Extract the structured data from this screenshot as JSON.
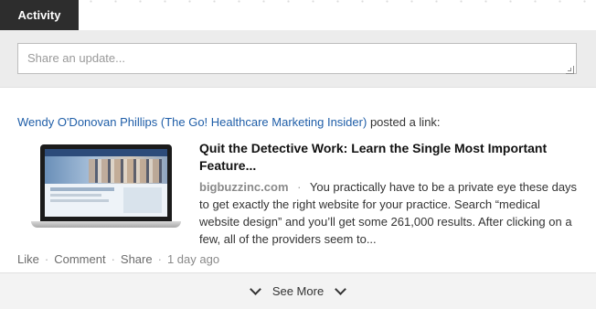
{
  "tabs": {
    "activity": "Activity"
  },
  "share": {
    "placeholder": "Share an update..."
  },
  "post": {
    "actor": "Wendy O'Donovan Phillips (The Go! Healthcare Marketing Insider)",
    "action": "posted a link:",
    "headline": "Quit the Detective Work: Learn the Single Most Important Feature...",
    "domain": "bigbuzzinc.com",
    "separator": "·",
    "summary": "You practically have to be a private eye these days to get exactly the right website for your practice. Search “medical website design” and you’ll get some 261,000 results. After clicking on a few, all of the providers seem to..."
  },
  "actions": {
    "like": "Like",
    "comment": "Comment",
    "share": "Share",
    "dot": "·",
    "time": "1 day ago"
  },
  "footer": {
    "see_more": "See More"
  },
  "icons": [
    "chevron-down-icon",
    "resize-grip-icon",
    "laptop-thumbnail"
  ],
  "colors": {
    "link": "#1f5ea8",
    "tab_bg": "#2d2d2d",
    "share_bg": "#ececec"
  }
}
